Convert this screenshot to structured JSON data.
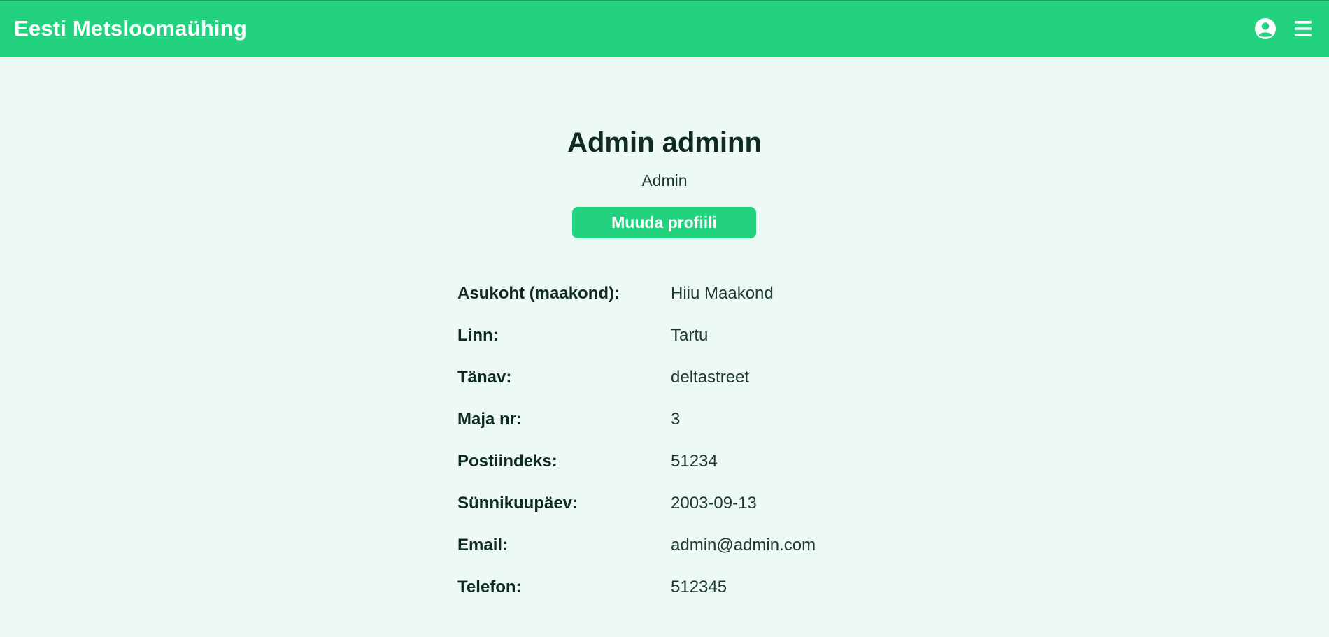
{
  "header": {
    "brand": "Eesti Metsloomaühing",
    "icons": [
      "user-circle-icon",
      "hamburger-menu-icon"
    ]
  },
  "profile": {
    "name": "Admin adminn",
    "role": "Admin",
    "edit_button": "Muuda profiili",
    "fields": [
      {
        "label": "Asukoht (maakond):",
        "value": "Hiiu Maakond"
      },
      {
        "label": "Linn:",
        "value": "Tartu"
      },
      {
        "label": "Tänav:",
        "value": "deltastreet"
      },
      {
        "label": "Maja nr:",
        "value": "3"
      },
      {
        "label": "Postiindeks:",
        "value": "51234"
      },
      {
        "label": "Sünnikuupäev:",
        "value": "2003-09-13"
      },
      {
        "label": "Email:",
        "value": "admin@admin.com"
      },
      {
        "label": "Telefon:",
        "value": "512345"
      }
    ]
  },
  "colors": {
    "accent": "#22d27f",
    "background": "#ecfaf3",
    "text": "#0f2a1f"
  }
}
